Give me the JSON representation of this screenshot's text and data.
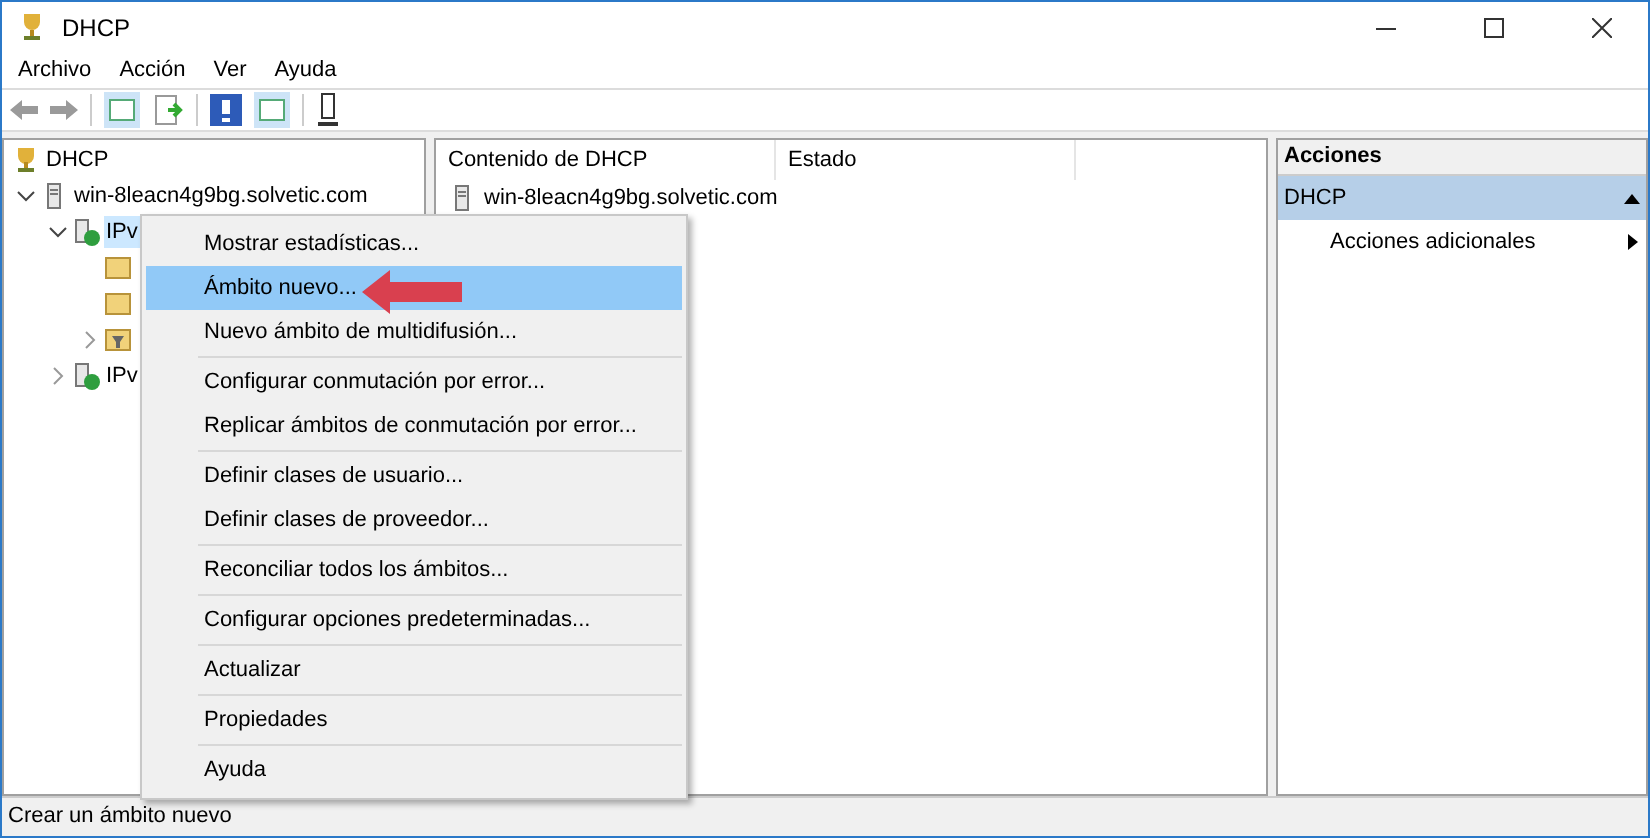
{
  "window": {
    "title": "DHCP"
  },
  "menu_bar": [
    "Archivo",
    "Acción",
    "Ver",
    "Ayuda"
  ],
  "tree": [
    {
      "label": "DHCP",
      "children": [
        {
          "label": "win-8leacn4g9bg.solvetic.com",
          "expanded": true,
          "children": [
            {
              "label": "IPv",
              "expanded": true,
              "selected": true,
              "children": [
                {
                  "kind": "folder"
                },
                {
                  "kind": "folder"
                },
                {
                  "kind": "filter",
                  "expanded": false
                }
              ]
            },
            {
              "label": "IPv",
              "expanded": false,
              "selected": false
            }
          ]
        }
      ]
    }
  ],
  "content": {
    "columns": [
      "Contenido de DHCP",
      "Estado"
    ],
    "rows": [
      {
        "name": "win-8leacn4g9bg.solvetic.com",
        "status": ""
      }
    ]
  },
  "actions": {
    "title": "Acciones",
    "section": {
      "label": "DHCP",
      "expanded": true
    },
    "items": [
      {
        "label": "Acciones adicionales"
      }
    ]
  },
  "context_menu": [
    [
      {
        "label": "Mostrar estadísticas...",
        "selected": false
      },
      {
        "label": "Ámbito nuevo...",
        "selected": true
      },
      {
        "label": "Nuevo ámbito de multidifusión...",
        "selected": false
      }
    ],
    [
      {
        "label": "Configurar conmutación por error...",
        "selected": false
      },
      {
        "label": "Replicar ámbitos de conmutación por error...",
        "selected": false
      }
    ],
    [
      {
        "label": "Definir clases de usuario...",
        "selected": false
      },
      {
        "label": "Definir clases de proveedor...",
        "selected": false
      }
    ],
    [
      {
        "label": "Reconciliar todos los ámbitos...",
        "selected": false
      }
    ],
    [
      {
        "label": "Configurar opciones predeterminadas...",
        "selected": false
      }
    ],
    [
      {
        "label": "Actualizar",
        "selected": false
      }
    ],
    [
      {
        "label": "Propiedades",
        "selected": false
      }
    ],
    [
      {
        "label": "Ayuda",
        "selected": false
      }
    ]
  ],
  "status_bar": "Crear un ámbito nuevo"
}
